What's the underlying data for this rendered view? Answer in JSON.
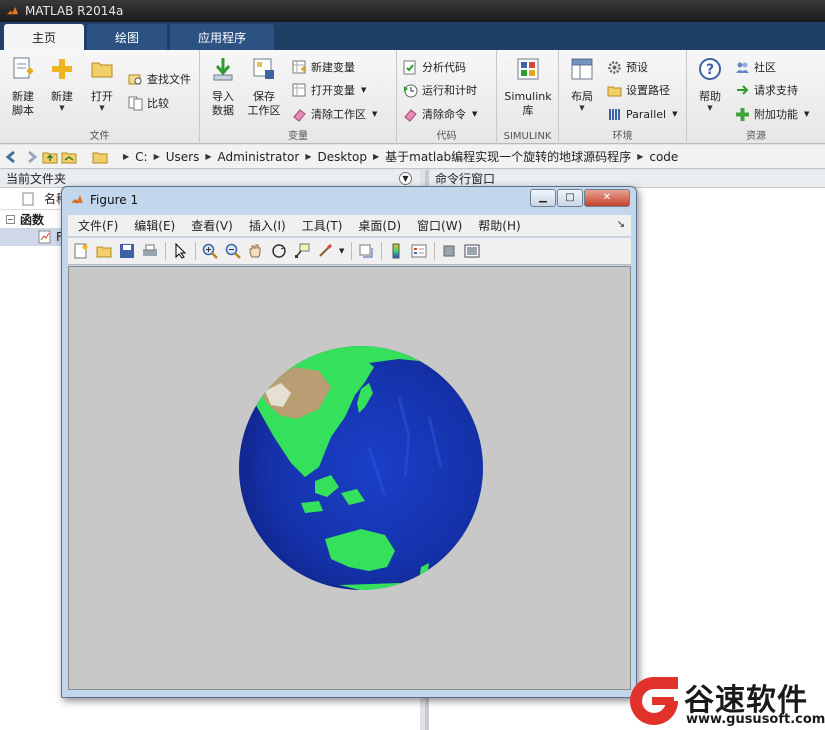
{
  "window": {
    "title": "MATLAB R2014a"
  },
  "tabs": [
    {
      "label": "主页"
    },
    {
      "label": "绘图"
    },
    {
      "label": "应用程序"
    }
  ],
  "ribbon": {
    "file": {
      "label": "文件",
      "new_script": "新建\n脚本",
      "new": "新建",
      "open": "打开",
      "find_files": "查找文件",
      "compare": "比较"
    },
    "variable": {
      "label": "变量",
      "import_data": "导入\n数据",
      "save_workspace": "保存\n工作区",
      "new_variable": "新建变量",
      "open_variable": "打开变量",
      "clear_workspace": "清除工作区"
    },
    "code": {
      "label": "代码",
      "analyze_code": "分析代码",
      "run_and_time": "运行和计时",
      "clear_commands": "清除命令"
    },
    "simulink": {
      "label": "SIMULINK",
      "simulink_library": "Simulink\n库"
    },
    "environment": {
      "label": "环境",
      "layout": "布局",
      "preferences": "预设",
      "set_path": "设置路径",
      "parallel": "Parallel"
    },
    "resources": {
      "label": "资源",
      "help": "帮助",
      "community": "社区",
      "request_support": "请求支持",
      "add_ons": "附加功能"
    }
  },
  "address": {
    "crumbs": [
      "C:",
      "Users",
      "Administrator",
      "Desktop",
      "基于matlab编程实现一个旋转的地球源码程序",
      "code"
    ]
  },
  "current_folder": {
    "title": "当前文件夹",
    "column_name": "名称",
    "group": "函数",
    "file": "F"
  },
  "command_window": {
    "title": "命令行窗口"
  },
  "figure": {
    "title": "Figure 1",
    "menu": [
      "文件(F)",
      "编辑(E)",
      "查看(V)",
      "插入(I)",
      "工具(T)",
      "桌面(D)",
      "窗口(W)",
      "帮助(H)"
    ],
    "tools": [
      "new-figure-icon",
      "open-file-icon",
      "save-icon",
      "print-icon",
      "select-arrow-icon",
      "zoom-in-icon",
      "zoom-out-icon",
      "pan-hand-icon",
      "rotate-3d-icon",
      "data-cursor-icon",
      "brush-icon",
      "link-plot-icon",
      "colorbar-icon",
      "legend-icon",
      "hide-plot-tools-icon",
      "show-plot-tools-icon"
    ],
    "plot": {
      "subject": "rotating globe",
      "ocean_color": "#1436b4",
      "land_color": "#32e05a",
      "desert_color": "#b49a6e",
      "background": "#c8c8c8"
    }
  },
  "watermark": {
    "text": "谷速软件",
    "url": "www.gususoft.com",
    "color": "#e0312a"
  }
}
